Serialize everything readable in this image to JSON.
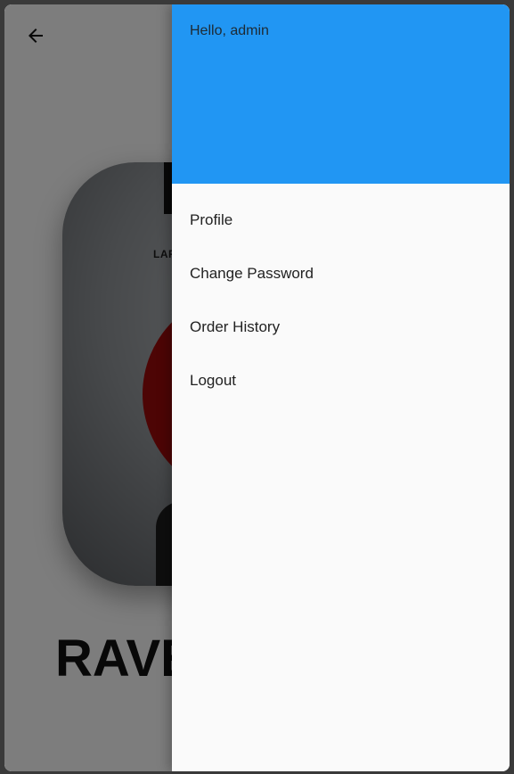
{
  "page": {
    "book_title_visible": "RAVE",
    "cover_author_visible": "LARS"
  },
  "drawer": {
    "greeting": "Hello, admin",
    "header_color": "#2196f3",
    "items": [
      {
        "label": "Profile"
      },
      {
        "label": "Change Password"
      },
      {
        "label": "Order History"
      },
      {
        "label": "Logout"
      }
    ]
  },
  "icons": {
    "back": "arrow-left-icon"
  }
}
